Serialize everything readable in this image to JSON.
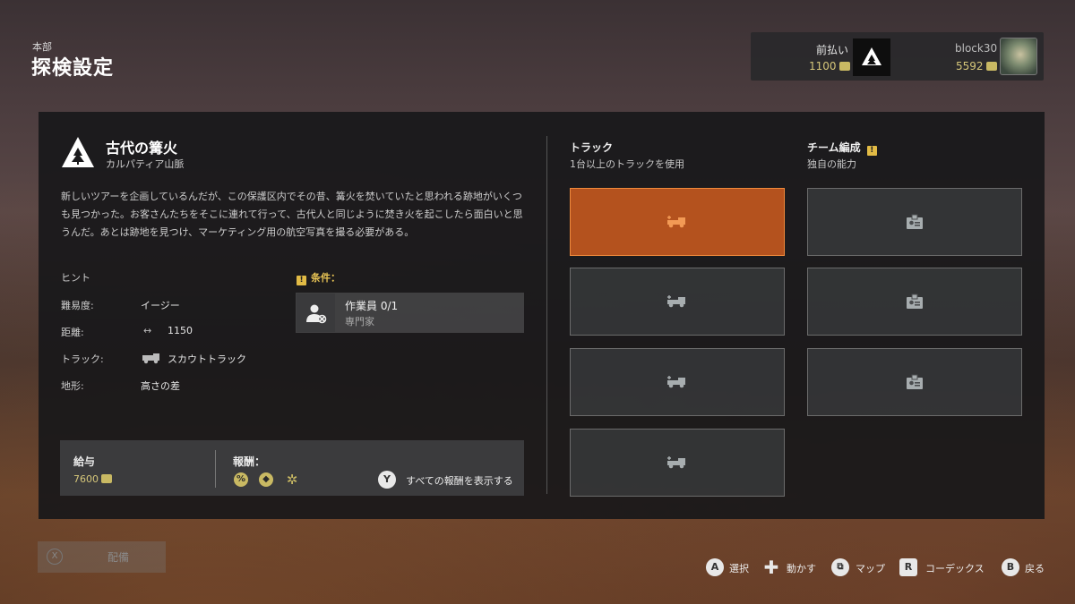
{
  "header": {
    "subtitle": "本部",
    "title": "探検設定"
  },
  "account": {
    "prepay_label": "前払い",
    "prepay_value": "1100",
    "user_name": "block30",
    "user_balance": "5592"
  },
  "mission": {
    "name": "古代の篝火",
    "region": "カルパティア山脈",
    "description": "新しいツアーを企画しているんだが、この保護区内でその昔、篝火を焚いていたと思われる跡地がいくつも見つかった。お客さんたちをそこに連れて行って、古代人と同じように焚き火を起こしたら面白いと思うんだ。あとは跡地を見つけ、マーケティング用の航空写真を撮る必要がある。"
  },
  "hints": {
    "title": "ヒント",
    "difficulty_label": "難易度:",
    "difficulty_value": "イージー",
    "distance_label": "距離:",
    "distance_value": "1150",
    "truck_label": "トラック:",
    "truck_value": "スカウトトラック",
    "terrain_label": "地形:",
    "terrain_value": "高さの差"
  },
  "conditions": {
    "title": "条件：",
    "items": [
      {
        "name": "作業員 0/1",
        "sub": "専門家"
      }
    ]
  },
  "rewards": {
    "pay_title": "給与",
    "pay_value": "7600",
    "reward_title": "報酬：",
    "icons": [
      "percent-reward-icon",
      "location-reward-icon",
      "gear-reward-icon"
    ],
    "show_all_button": "Y",
    "show_all_label": "すべての報酬を表示する"
  },
  "trucks": {
    "title": "トラック",
    "subtitle": "1台以上のトラックを使用",
    "slots": 4,
    "selected_slot": 0
  },
  "team": {
    "title": "チーム編成",
    "subtitle": "独自の能力",
    "slots": 3
  },
  "footer": {
    "deploy_button": "X",
    "deploy_label": "配備",
    "controls": [
      {
        "key": "A",
        "label": "選択"
      },
      {
        "key": "✚",
        "label": "動かす"
      },
      {
        "key": "⧉",
        "label": "マップ"
      },
      {
        "key": "R",
        "label": "コーデックス"
      },
      {
        "key": "B",
        "label": "戻る"
      }
    ]
  },
  "colors": {
    "accent_orange": "#d65f1e",
    "gold": "#d6c77a",
    "warning": "#e2bb45"
  }
}
